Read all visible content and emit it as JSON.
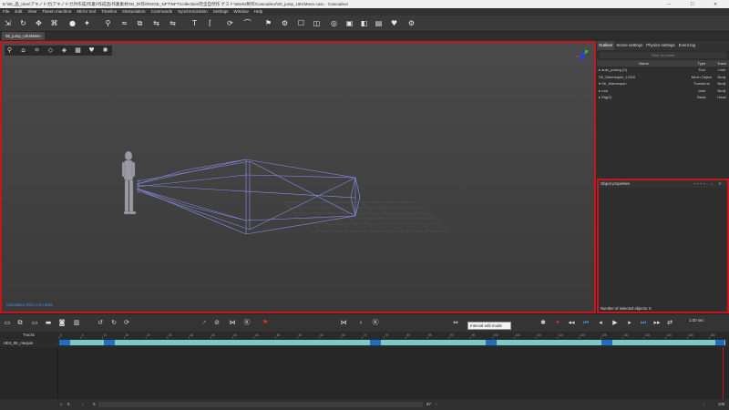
{
  "window": {
    "title": "E:\\06_品_time\\アキノドガ(アキノドガ外作成)作業\\\\作成品\\作業素材\\00_D\\作\\\\RGGE_NFT\\NFT\\collection\\完全自然作 ゲスト\\Works制作\\Cascadeur\\00_jump_UE4Mann.casc - Cascadeur",
    "controls": "—  ☐  ✕"
  },
  "menu": [
    "File",
    "Edit",
    "View",
    "Tween machine",
    "Mirror tool",
    "Timeline",
    "Interpolation",
    "Commands",
    "Synchronization",
    "Settings",
    "Window",
    "Help"
  ],
  "toolbar_icons": [
    "selection-icon",
    "rotate-icon",
    "move-icon",
    "joint-icon",
    "point-icon",
    "pin-icon",
    "walk-icon",
    "curve-icon",
    "copy-icon",
    "flip-icon",
    "text-icon",
    "bracket-icon",
    "loop-icon",
    "arc-icon",
    "run-icon",
    "physics-icon",
    "ghost-icon",
    "fix-icon",
    "target-icon",
    "layers-icon",
    "capture-icon",
    "render-icon",
    "export-icon",
    "settings-icon"
  ],
  "doc_tab": "00_jump_UE4Mann",
  "viewport": {
    "build_text": "Cascadeur 2022.1 EA Beta",
    "tools": [
      "rig-icon",
      "frame-icon",
      "joints-icon",
      "cube-icon",
      "mesh-icon",
      "box-icon",
      "heart-icon",
      "light-icon"
    ]
  },
  "right_panel": {
    "tabs": [
      "Outliner",
      "Scene settings",
      "Physics settings",
      "Event log"
    ],
    "filter_placeholder": "Filter by name",
    "columns": [
      "Name",
      "Type",
      "Track"
    ],
    "rows": [
      {
        "name": "▸ auto_posing (0)",
        "type": "Tool",
        "track": "Limb"
      },
      {
        "name": "  SK_Mannequin_LOD0",
        "type": "Mesh Object",
        "track": "Body"
      },
      {
        "name": "▾ SK_Mannequin",
        "type": "Transform",
        "track": "Body"
      },
      {
        "name": "    ▸ root",
        "type": "Joint",
        "track": "Body"
      },
      {
        "name": "▸ Rig(0)",
        "type": "Basic",
        "track": "Head"
      }
    ],
    "object_properties_title": "Object properties",
    "selected_count": "Number of selected objects: 0"
  },
  "bottom_toolbar": {
    "tooltip": "Interval edit mode",
    "speed": "1.00 sec",
    "frame_marker": "K"
  },
  "timeline": {
    "tracks_header": "Tracks",
    "track_name": "UE4_SK_mequin",
    "ruler_ticks": [
      "0",
      "5",
      "10",
      "15",
      "20",
      "25",
      "30",
      "35",
      "40",
      "45",
      "50",
      "55",
      "60",
      "65",
      "70",
      "75",
      "80",
      "85",
      "90",
      "95",
      "100",
      "105",
      "110",
      "115",
      "120",
      "125",
      "130",
      "135",
      "140",
      "145",
      "150"
    ],
    "current_frame": "0",
    "start_frame": "0",
    "end_frame": "97",
    "zoom": "100"
  },
  "colors": {
    "accent_red": "#c4161c",
    "key_blue": "#1e6fc2",
    "interval_teal": "#7ec9c7",
    "rig_lines": "#8a8ce8"
  }
}
